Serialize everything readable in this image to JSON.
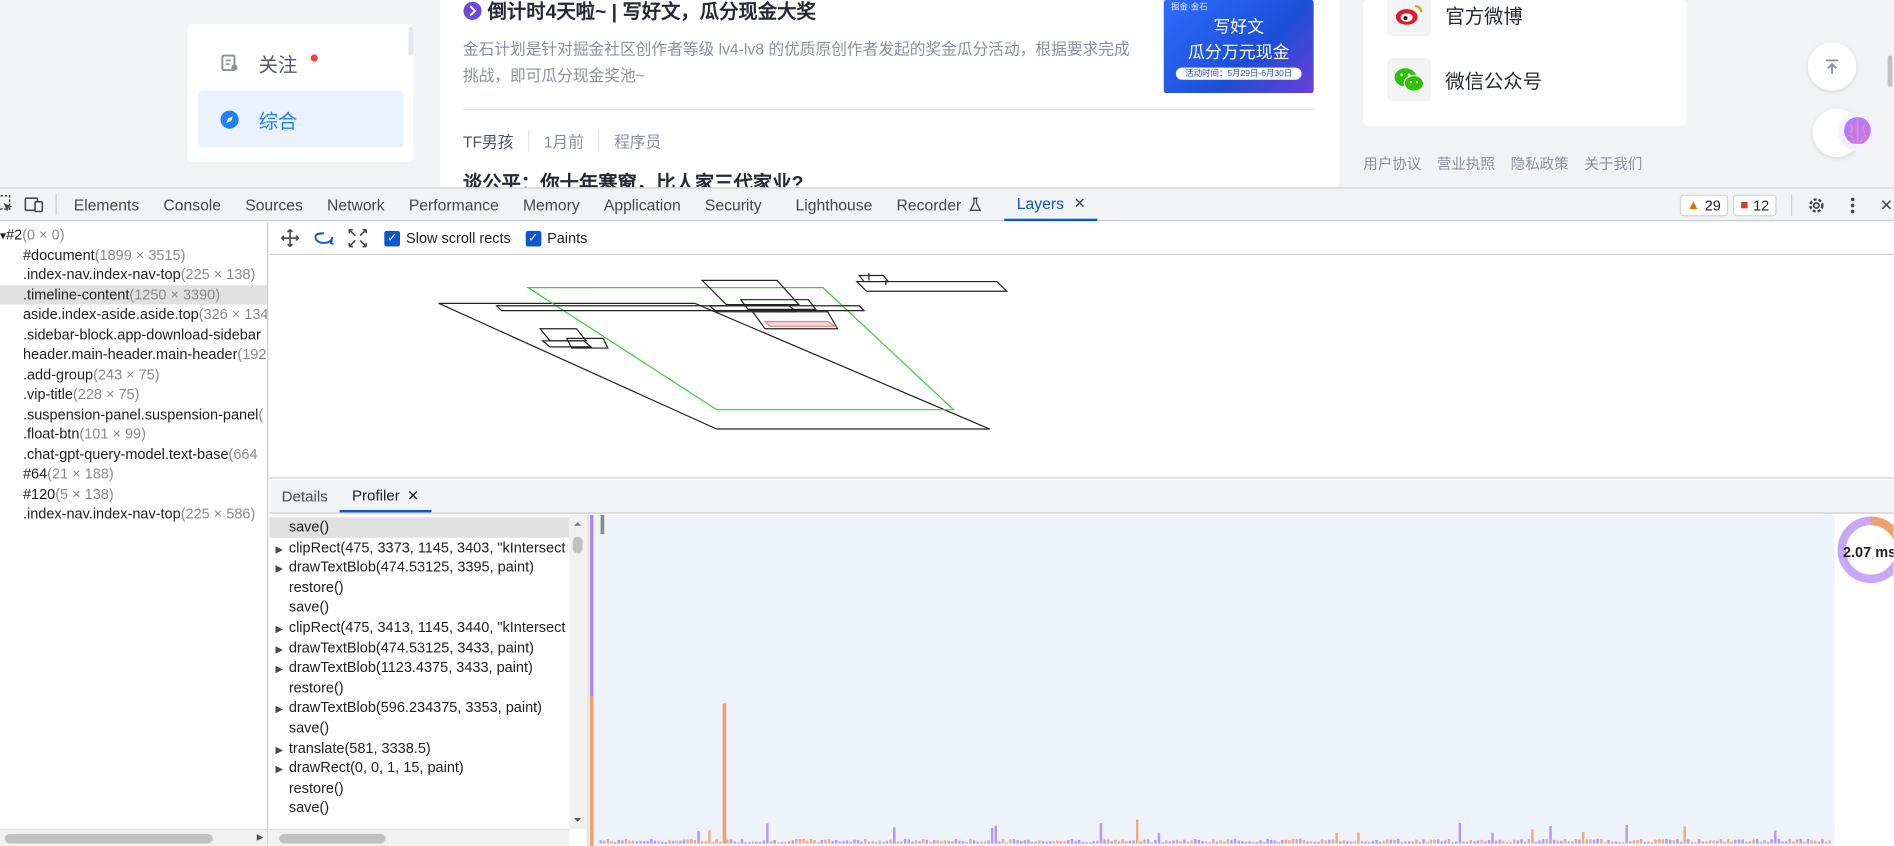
{
  "page": {
    "nav": {
      "follow_label": "关注",
      "general_label": "综合"
    },
    "feed": {
      "title": "倒计时4天啦~ | 写好文，瓜分现金大奖",
      "description": "金石计划是针对掘金社区创作者等级 lv4-lv8 的优质原创作者发起的奖金瓜分活动，根据要求完成挑战，即可瓜分现金奖池~",
      "ad": {
        "tag": "掘金·金石",
        "line1": "写好文",
        "line2": "瓜分万元现金",
        "line3": "活动时间：5月29日-6月30日"
      },
      "author": "TF男孩",
      "time": "1月前",
      "category": "程序员",
      "title2": "谈公平：你十年寒窗，比人家三代家业?"
    },
    "side": {
      "weibo": "官方微博",
      "wechat": "微信公众号"
    },
    "footer_links": [
      "用户协议",
      "营业执照",
      "隐私政策",
      "关于我们"
    ]
  },
  "devtools": {
    "tabs": [
      "Elements",
      "Console",
      "Sources",
      "Network",
      "Performance",
      "Memory",
      "Application",
      "Security",
      "Lighthouse",
      "Recorder",
      "Layers"
    ],
    "active_tab": "Layers",
    "warnings": "29",
    "errors": "12",
    "colors": {
      "accent": "#0b57d0",
      "warn": "#e37400",
      "error": "#dc362e"
    }
  },
  "layers": {
    "tree": [
      {
        "name": "#2",
        "dim": "(0 × 0)",
        "root": true
      },
      {
        "name": "#document",
        "dim": "(1899 × 3515)"
      },
      {
        "name": ".index-nav.index-nav-top",
        "dim": "(225 × 138)"
      },
      {
        "name": ".timeline-content",
        "dim": "(1250 × 3390)",
        "selected": true
      },
      {
        "name": "aside.index-aside.aside.top",
        "dim": "(326 × 134"
      },
      {
        "name": ".sidebar-block.app-download-sidebar",
        "dim": ""
      },
      {
        "name": "header.main-header.main-header",
        "dim": "(192"
      },
      {
        "name": ".add-group",
        "dim": "(243 × 75)"
      },
      {
        "name": ".vip-title",
        "dim": "(228 × 75)"
      },
      {
        "name": ".suspension-panel.suspension-panel",
        "dim": "("
      },
      {
        "name": ".float-btn",
        "dim": "(101 × 99)"
      },
      {
        "name": ".chat-gpt-query-model.text-base",
        "dim": "(664"
      },
      {
        "name": "#64",
        "dim": "(21 × 188)"
      },
      {
        "name": "#120",
        "dim": "(5 × 138)"
      },
      {
        "name": ".index-nav.index-nav-top",
        "dim": "(225 × 586)"
      }
    ],
    "toolbar": {
      "slow_scroll": "Slow scroll rects",
      "paints": "Paints"
    },
    "subtabs": {
      "details": "Details",
      "profiler": "Profiler"
    },
    "profiler_log": [
      {
        "text": "save()",
        "expandable": false,
        "selected": true
      },
      {
        "text": "clipRect(475, 3373, 1145, 3403, \"kIntersect",
        "expandable": true
      },
      {
        "text": "drawTextBlob(474.53125, 3395, paint)",
        "expandable": true
      },
      {
        "text": "restore()",
        "expandable": false
      },
      {
        "text": "save()",
        "expandable": false
      },
      {
        "text": "clipRect(475, 3413, 1145, 3440, \"kIntersect",
        "expandable": true
      },
      {
        "text": "drawTextBlob(474.53125, 3433, paint)",
        "expandable": true
      },
      {
        "text": "drawTextBlob(1123.4375, 3433, paint)",
        "expandable": true
      },
      {
        "text": "restore()",
        "expandable": false
      },
      {
        "text": "drawTextBlob(596.234375, 3353, paint)",
        "expandable": true
      },
      {
        "text": "save()",
        "expandable": false
      },
      {
        "text": "translate(581, 3338.5)",
        "expandable": true
      },
      {
        "text": "drawRect(0, 0, 1, 15, paint)",
        "expandable": true
      },
      {
        "text": "restore()",
        "expandable": false
      },
      {
        "text": "save()",
        "expandable": false
      }
    ],
    "paint_time": "2.07 ms"
  }
}
